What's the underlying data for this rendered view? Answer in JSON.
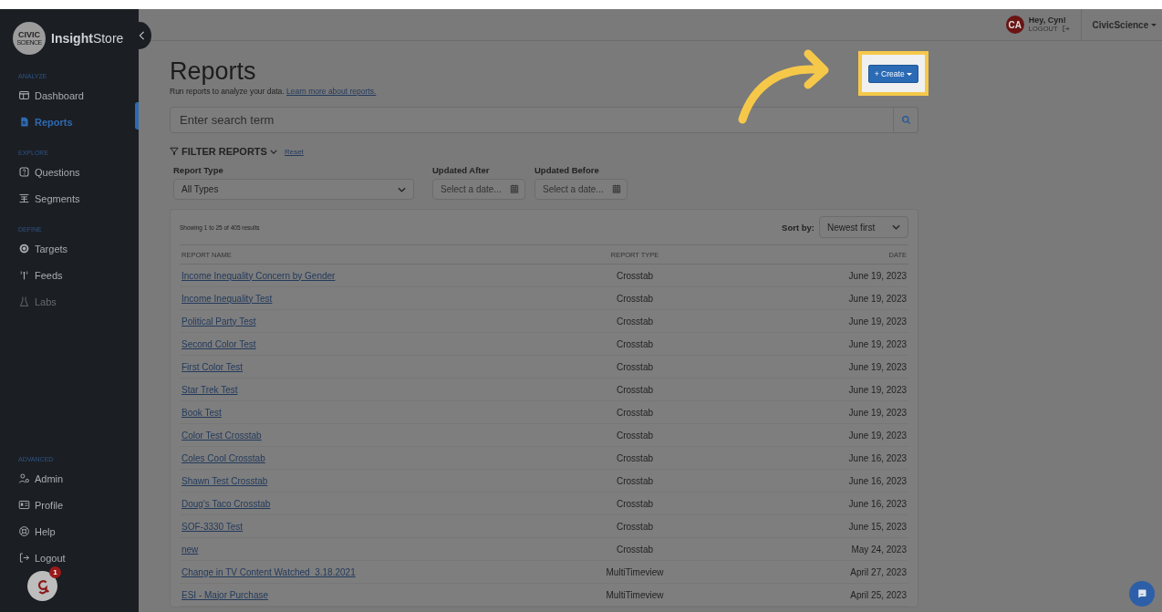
{
  "sidebar": {
    "brand": {
      "logo_text": "CIVIC",
      "logo_subtext": "SCIENCE",
      "name_bold": "Insight",
      "name_rest": "Store"
    },
    "sections": [
      {
        "heading": "ANALYZE",
        "items": [
          {
            "label": "Dashboard",
            "selected": false,
            "disabled": false
          },
          {
            "label": "Reports",
            "selected": true,
            "disabled": false
          }
        ]
      },
      {
        "heading": "EXPLORE",
        "items": [
          {
            "label": "Questions",
            "selected": false,
            "disabled": false
          },
          {
            "label": "Segments",
            "selected": false,
            "disabled": false
          }
        ]
      },
      {
        "heading": "DEFINE",
        "items": [
          {
            "label": "Targets",
            "selected": false,
            "disabled": false
          },
          {
            "label": "Feeds",
            "selected": false,
            "disabled": false
          },
          {
            "label": "Labs",
            "selected": false,
            "disabled": true
          }
        ]
      },
      {
        "heading": "ADVANCED",
        "items": [
          {
            "label": "Admin",
            "selected": false,
            "disabled": false
          },
          {
            "label": "Profile",
            "selected": false,
            "disabled": false
          },
          {
            "label": "Help",
            "selected": false,
            "disabled": false
          },
          {
            "label": "Logout",
            "selected": false,
            "disabled": false
          }
        ]
      }
    ],
    "assistant_badge": "1"
  },
  "header": {
    "avatar_initials": "CA",
    "greeting": "Hey, Cyn!",
    "logout": "LOGOUT",
    "org_menu": "CivicScience"
  },
  "page": {
    "title": "Reports",
    "subtitle": "Run reports to analyze your data.",
    "subtitle_link": "Learn more about reports.",
    "create_button": "+ Create",
    "search": {
      "placeholder": "Enter search term"
    },
    "filters": {
      "title": "FILTER REPORTS",
      "reset": "Reset",
      "report_type": {
        "label": "Report Type",
        "value": "All Types"
      },
      "updated_after": {
        "label": "Updated After",
        "placeholder": "Select a date..."
      },
      "updated_before": {
        "label": "Updated Before",
        "placeholder": "Select a date..."
      }
    }
  },
  "table": {
    "summary": "Showing 1 to 25 of 405 results",
    "sort_label": "Sort by:",
    "sort_value": "Newest first",
    "columns": [
      "REPORT NAME",
      "REPORT TYPE",
      "DATE"
    ],
    "rows": [
      {
        "name": "Income Inequality Concern by Gender",
        "type": "Crosstab",
        "date": "June 19, 2023"
      },
      {
        "name": "Income Inequality Test",
        "type": "Crosstab",
        "date": "June 19, 2023"
      },
      {
        "name": "Political Party Test",
        "type": "Crosstab",
        "date": "June 19, 2023"
      },
      {
        "name": "Second Color Test",
        "type": "Crosstab",
        "date": "June 19, 2023"
      },
      {
        "name": "First Color Test",
        "type": "Crosstab",
        "date": "June 19, 2023"
      },
      {
        "name": "Star Trek Test",
        "type": "Crosstab",
        "date": "June 19, 2023"
      },
      {
        "name": "Book Test",
        "type": "Crosstab",
        "date": "June 19, 2023"
      },
      {
        "name": "Color Test Crosstab",
        "type": "Crosstab",
        "date": "June 19, 2023"
      },
      {
        "name": "Coles Cool Crosstab",
        "type": "Crosstab",
        "date": "June 16, 2023"
      },
      {
        "name": "Shawn Test Crosstab",
        "type": "Crosstab",
        "date": "June 16, 2023"
      },
      {
        "name": "Doug's Taco Crosstab",
        "type": "Crosstab",
        "date": "June 16, 2023"
      },
      {
        "name": "SOF-3330 Test",
        "type": "Crosstab",
        "date": "June 15, 2023"
      },
      {
        "name": "new",
        "type": "Crosstab",
        "date": "May 24, 2023"
      },
      {
        "name": "Change in TV Content Watched_3.18.2021",
        "type": "MultiTimeview",
        "date": "April 27, 2023"
      },
      {
        "name": "ESI - Major Purchase",
        "type": "MultiTimeview",
        "date": "April 25, 2023"
      }
    ]
  }
}
